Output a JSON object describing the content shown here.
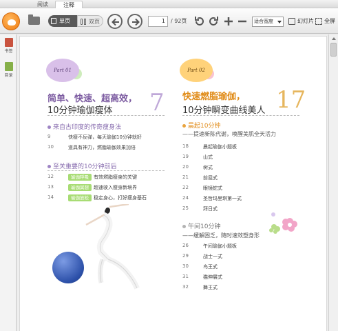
{
  "tabs": [
    {
      "label": "阅读"
    },
    {
      "label": "注释"
    }
  ],
  "toolbar": {
    "single_page": "单页",
    "double_page": "双页",
    "current_page": "1",
    "total_pages": "/ 92页",
    "zoom": "适合宽度",
    "slideshow": "幻灯片",
    "fullscreen": "全屏",
    "icons": [
      "logo-icon",
      "folder-icon",
      "single-page-icon",
      "double-page-icon",
      "prev-page-icon",
      "next-page-icon",
      "rotate-left-icon",
      "rotate-right-icon",
      "zoom-in-icon",
      "zoom-out-icon",
      "slideshow-icon",
      "fullscreen-icon"
    ]
  },
  "sidebar": {
    "bookmark": "书签",
    "toc": "目录"
  },
  "page": {
    "left": {
      "badge": "Part 01",
      "title1": "简单、快速、超高效，",
      "title2": "10分钟瑜伽瘦体",
      "bignum": "7",
      "section1": "来自古印度的传奇瘦身法",
      "section1_items": [
        {
          "num": "9",
          "text": "快瘦不反弹，每天瑜伽10分钟就好"
        },
        {
          "num": "10",
          "text": "道具有神力，燃脂瑜伽效果加倍"
        }
      ],
      "section2": "至关重要的10分钟前后",
      "section2_items": [
        {
          "num": "12",
          "tag": "瑜伽呼吸",
          "text": "有效燃脂瘦身的关键"
        },
        {
          "num": "13",
          "tag": "瑜伽冥想",
          "text": "超速驶入瘦身新境界"
        },
        {
          "num": "14",
          "tag": "瑜伽放松",
          "text": "稳定身心，打好瘦身基石"
        }
      ]
    },
    "right": {
      "badge": "Part 02",
      "title1": "快速燃脂瑜伽，",
      "title2": "10分钟瞬变曲线美人",
      "bignum": "17",
      "section1": "晨起10分钟",
      "section1_sub": "——提速新陈代谢，唤醒美肌全天活力",
      "section1_items": [
        {
          "num": "18",
          "text": "晨起瑜伽小题板"
        },
        {
          "num": "19",
          "text": "山式"
        },
        {
          "num": "20",
          "text": "树式"
        },
        {
          "num": "21",
          "text": "前屈式"
        },
        {
          "num": "22",
          "text": "眼镜蛇式"
        },
        {
          "num": "24",
          "text": "圣哲玛里琪第一式"
        },
        {
          "num": "25",
          "text": "拜日式"
        }
      ],
      "section2": "午间10分钟",
      "section2_sub": "——缓解困乏，随时速效塑身形",
      "section2_items": [
        {
          "num": "26",
          "text": "午间瑜伽小题板"
        },
        {
          "num": "29",
          "text": "战士一式"
        },
        {
          "num": "30",
          "text": "鸟王式"
        },
        {
          "num": "31",
          "text": "猫伸展式"
        },
        {
          "num": "32",
          "text": "舞王式"
        }
      ]
    }
  },
  "colors": {
    "accent_orange": "#f07d14",
    "purple": "#8a6fb0",
    "orange_text": "#e18d1c",
    "tag_green": "#a8dc74"
  }
}
